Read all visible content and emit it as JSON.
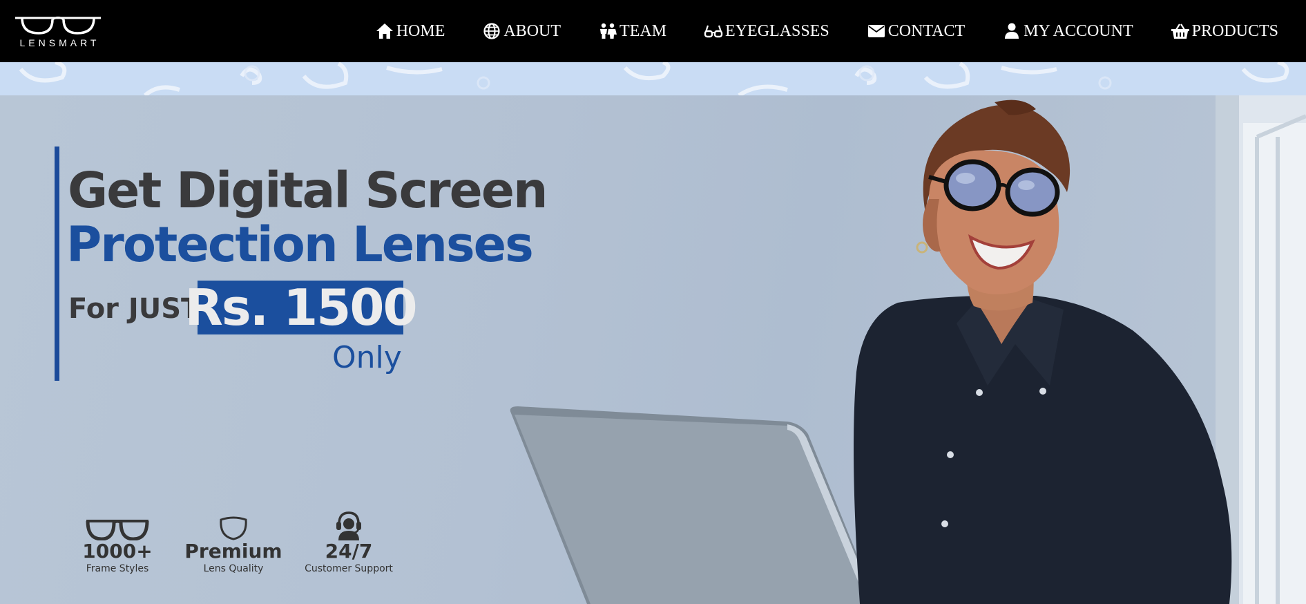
{
  "brand": {
    "name": "LENSMART"
  },
  "nav": {
    "items": [
      {
        "label": "HOME",
        "icon": "home-icon"
      },
      {
        "label": "ABOUT",
        "icon": "globe-icon"
      },
      {
        "label": "TEAM",
        "icon": "people-icon"
      },
      {
        "label": "EYEGLASSES",
        "icon": "eyeglasses-icon"
      },
      {
        "label": "CONTACT",
        "icon": "envelope-icon"
      },
      {
        "label": "MY ACCOUNT",
        "icon": "user-icon"
      },
      {
        "label": "PRODUCTS",
        "icon": "basket-icon"
      }
    ]
  },
  "hero": {
    "headline_line1": "Get Digital Screen",
    "headline_line2": "Protection Lenses",
    "price_prefix": "For JUST",
    "price": "Rs. 1500",
    "price_suffix": "Only",
    "features": [
      {
        "title": "1000+",
        "subtitle": "Frame Styles",
        "icon": "eyeglasses-icon"
      },
      {
        "title": "Premium",
        "subtitle": "Lens Quality",
        "icon": "lens-icon"
      },
      {
        "title": "24/7",
        "subtitle": "Customer Support",
        "icon": "headset-support-icon"
      }
    ]
  },
  "colors": {
    "nav_background": "#000000",
    "brand_blue": "#1b4f9e",
    "headline_dark": "#3a3a3c",
    "pattern_strip": "#c9dcf4",
    "hero_background": "#b3c2d4"
  }
}
